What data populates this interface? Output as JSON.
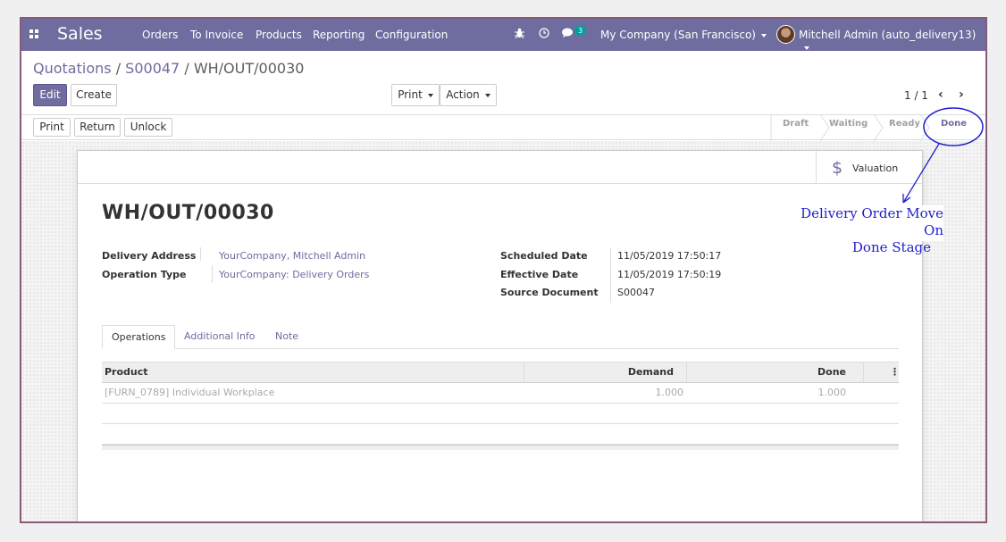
{
  "navbar": {
    "app_name": "Sales",
    "menu": [
      "Orders",
      "To Invoice",
      "Products",
      "Reporting",
      "Configuration"
    ],
    "message_count": "3",
    "company": "My Company (San Francisco)",
    "user": "Mitchell Admin (auto_delivery13)",
    "background_color": "#6f6c9f"
  },
  "breadcrumb": {
    "root": "Quotations",
    "separator": "/",
    "parent": "S00047",
    "current": "WH/OUT/00030"
  },
  "control_panel": {
    "edit_label": "Edit",
    "create_label": "Create",
    "print_label": "Print",
    "action_label": "Action",
    "pager_value": "1 / 1"
  },
  "statusbar": {
    "buttons": [
      "Print",
      "Return",
      "Unlock"
    ],
    "stages": [
      "Draft",
      "Waiting",
      "Ready",
      "Done"
    ],
    "active_stage": "Done"
  },
  "sheet": {
    "valuation_label": "Valuation",
    "title": "WH/OUT/00030",
    "fields_left": [
      {
        "label": "Delivery Address",
        "value": "YourCompany, Mitchell Admin"
      },
      {
        "label": "Operation Type",
        "value": "YourCompany: Delivery Orders"
      }
    ],
    "fields_right": [
      {
        "label": "Scheduled Date",
        "value": "11/05/2019 17:50:17"
      },
      {
        "label": "Effective Date",
        "value": "11/05/2019 17:50:19"
      },
      {
        "label": "Source Document",
        "value": "S00047"
      }
    ],
    "tabs": [
      "Operations",
      "Additional Info",
      "Note"
    ],
    "active_tab": "Operations",
    "table": {
      "headers": [
        "Product",
        "Demand",
        "Done"
      ],
      "rows": [
        {
          "product": "[FURN_0789] Individual Workplace",
          "demand": "1.000",
          "done": "1.000"
        }
      ]
    }
  },
  "annotation": {
    "line1": "Delivery Order Move On",
    "line2": "Done Stage",
    "color": "#1f1fcc"
  }
}
